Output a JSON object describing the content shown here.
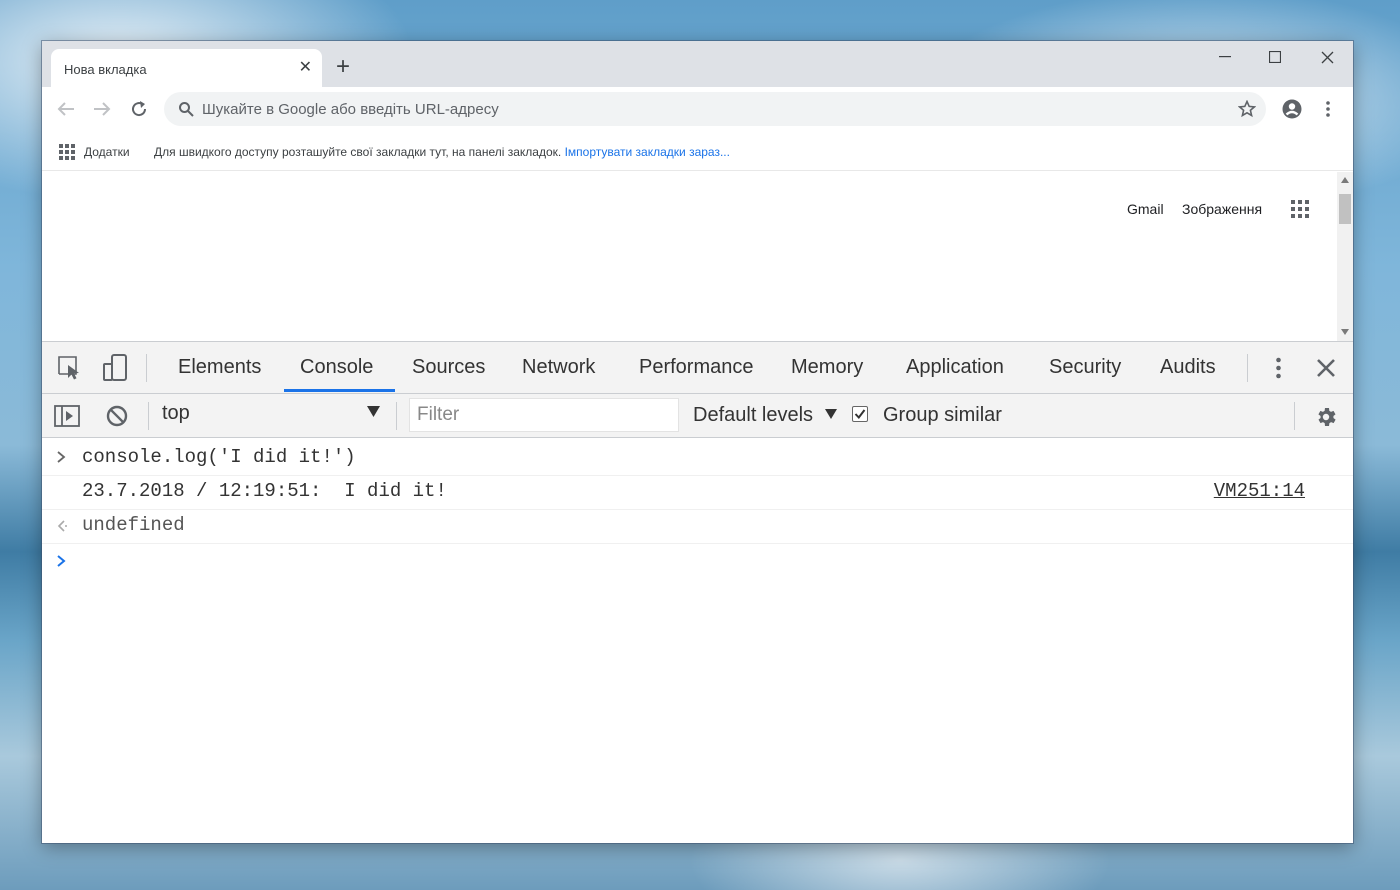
{
  "browser": {
    "tab_title": "Нова вкладка",
    "omnibox_placeholder": "Шукайте в Google або введіть URL-адресу",
    "bookmarks": {
      "apps_label": "Додатки",
      "hint_text": "Для швидкого доступу розташуйте свої закладки тут, на панелі закладок.",
      "import_link": "Імпортувати закладки зараз..."
    }
  },
  "page": {
    "links": [
      "Gmail",
      "Зображення"
    ]
  },
  "devtools": {
    "tabs": [
      "Elements",
      "Console",
      "Sources",
      "Network",
      "Performance",
      "Memory",
      "Application",
      "Security",
      "Audits"
    ],
    "active_tab": "Console",
    "context": "top",
    "filter_placeholder": "Filter",
    "levels": "Default levels",
    "group_similar_label": "Group similar",
    "group_similar_checked": true,
    "console": {
      "input_command": "console.log('I did it!')",
      "log_message": "23.7.2018 / 12:19:51:  I did it!",
      "log_source": "VM251:14",
      "return_value": "undefined"
    }
  },
  "colors": {
    "accent": "#1a73e8",
    "prompt": "#1a73e8",
    "tabstrip": "#dee1e6"
  }
}
